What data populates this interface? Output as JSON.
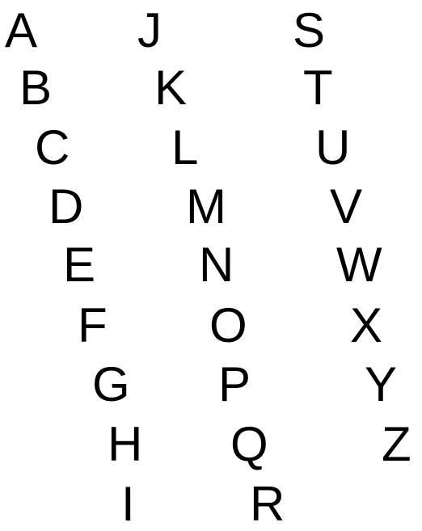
{
  "columns": [
    {
      "letters": [
        "A",
        "B",
        "C",
        "D",
        "E",
        "F",
        "G",
        "H",
        "I"
      ]
    },
    {
      "letters": [
        "J",
        "K",
        "L",
        "M",
        "N",
        "O",
        "P",
        "Q",
        "R"
      ]
    },
    {
      "letters": [
        "S",
        "T",
        "U",
        "V",
        "W",
        "X",
        "Y",
        "Z"
      ]
    }
  ],
  "colors": {
    "text": "#000000",
    "background": "#ffffff"
  }
}
